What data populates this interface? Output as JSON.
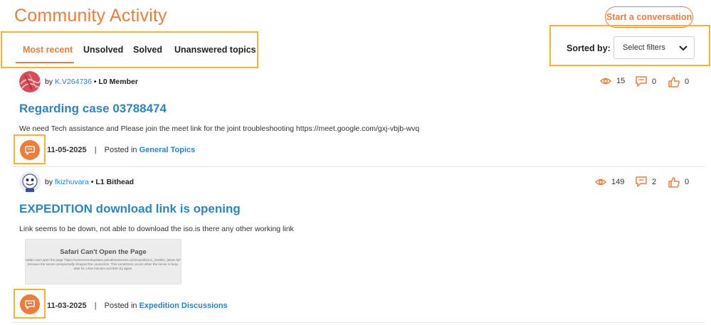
{
  "page": {
    "title": "Community Activity"
  },
  "header": {
    "start_button": "Start a conversation"
  },
  "tabs": [
    {
      "label": "Most recent",
      "active": true
    },
    {
      "label": "Unsolved",
      "active": false
    },
    {
      "label": "Solved",
      "active": false
    },
    {
      "label": "Unanswered topics",
      "active": false
    }
  ],
  "sort": {
    "label": "Sorted by:",
    "selected": "Select filters"
  },
  "posts": [
    {
      "by": "by",
      "username": "K.V264736",
      "rank": "L0 Member",
      "title": "Regarding case 03788474",
      "body": "We need Tech assistance and Please join the meet link for the joint troubleshooting https://meet.google.com/gxj-vbjb-wvq",
      "date": "11-05-2025",
      "posted_in": "Posted in",
      "category": "General Topics",
      "views": "15",
      "replies": "0",
      "kudos": "0"
    },
    {
      "by": "by",
      "username": "fkizhuvara",
      "rank": "L1 Bithead",
      "title": "EXPEDITION download link is opening",
      "body": "Link seems to be down, not able to download the iso.is there any other working link",
      "date": "11-03-2025",
      "posted_in": "Posted in",
      "category": "Expedition Discussions",
      "views": "149",
      "replies": "2",
      "kudos": "0",
      "attachment": {
        "heading": "Safari Can't Open the Page",
        "text": "Safari can't open the page \"https://conversiondupdates.paloaltonetworks.com/expedition1_installer_latest.zip\" because the server unexpectedly dropped the connection. This sometimes occurs when the server is busy. Wait for a few minutes and then try again."
      }
    }
  ],
  "colors": {
    "accent": "#f07c3a",
    "link": "#2b86c4",
    "highlight_box": "#f7b32b"
  },
  "icons": {
    "views": "eye-icon",
    "replies": "comment-icon",
    "kudos": "thumbs-up-icon",
    "message": "message-icon",
    "select": "chevron-down-icon"
  }
}
